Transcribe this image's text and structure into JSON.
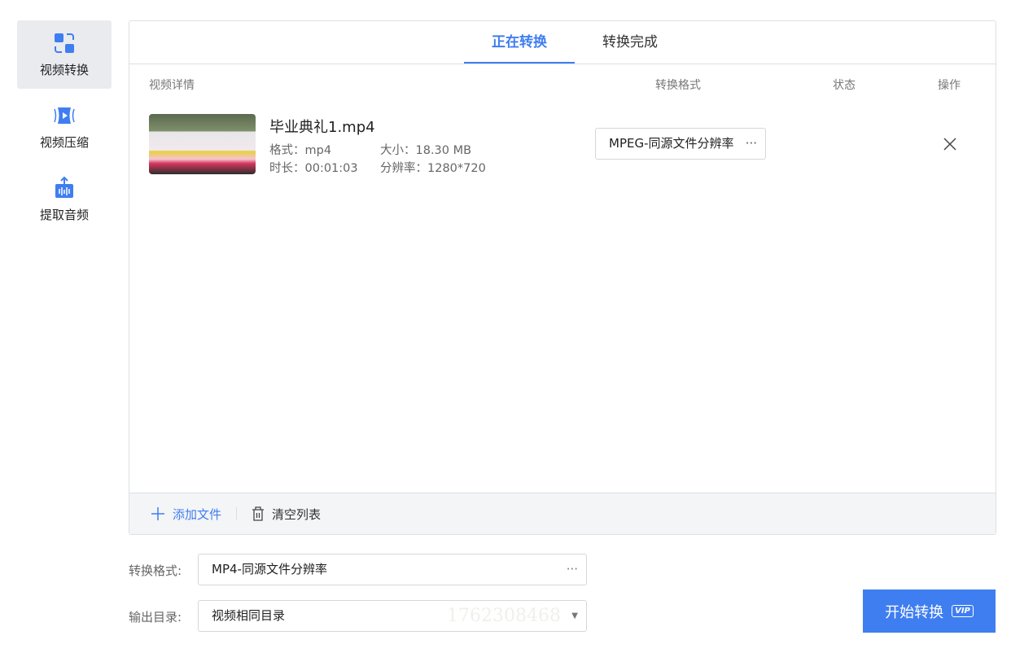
{
  "sidebar": {
    "items": [
      {
        "label": "视频转换",
        "icon": "convert-icon"
      },
      {
        "label": "视频压缩",
        "icon": "compress-icon"
      },
      {
        "label": "提取音频",
        "icon": "audio-extract-icon"
      }
    ]
  },
  "tabs": [
    "正在转换",
    "转换完成"
  ],
  "columns": {
    "details": "视频详情",
    "format": "转换格式",
    "status": "状态",
    "action": "操作"
  },
  "files": [
    {
      "name": "毕业典礼1.mp4",
      "format_label": "格式：",
      "format": "mp4",
      "size_label": "大小：",
      "size": "18.30 MB",
      "duration_label": "时长：",
      "duration": "00:01:03",
      "resolution_label": "分辨率：",
      "resolution": "1280*720",
      "target_format": "MPEG-同源文件分辨率",
      "more": "···"
    }
  ],
  "footer": {
    "add": "添加文件",
    "clear": "清空列表"
  },
  "settings": {
    "format_label": "转换格式:",
    "format_value": "MP4-同源文件分辨率",
    "format_more": "···",
    "output_label": "输出目录:",
    "output_value": "视频相同目录",
    "watermark": "1762308468"
  },
  "start_button": {
    "label": "开始转换",
    "badge": "VIP"
  },
  "colors": {
    "accent": "#3f7ef0"
  }
}
